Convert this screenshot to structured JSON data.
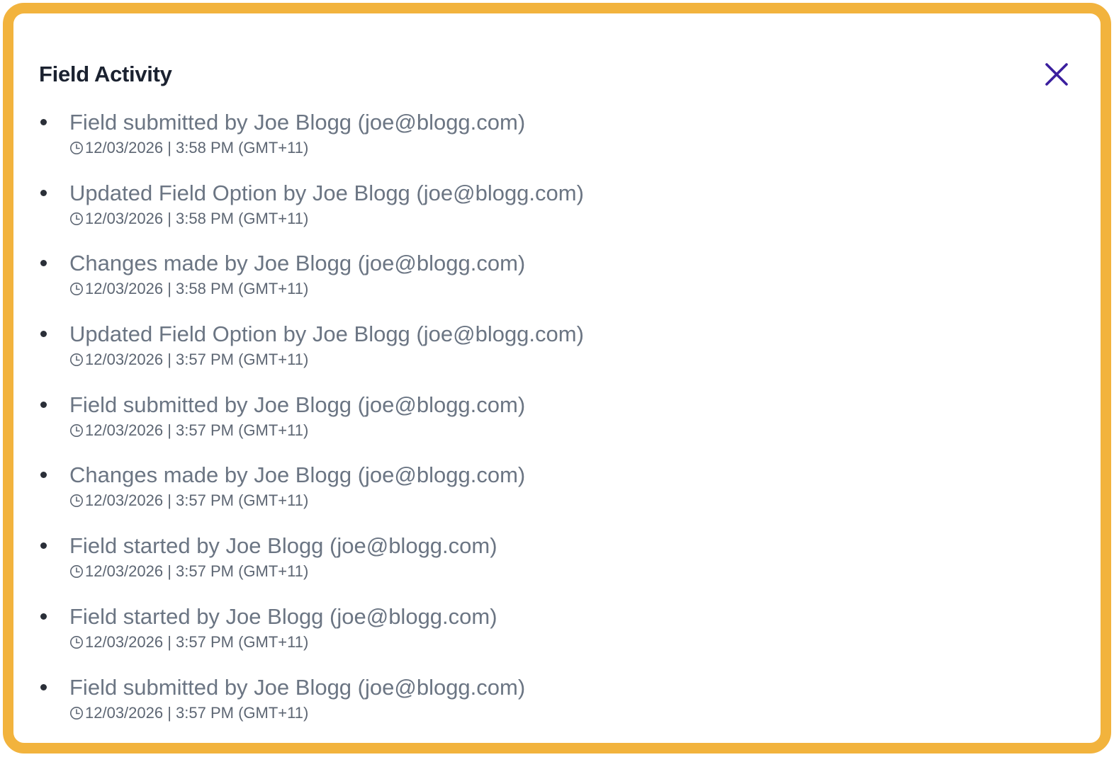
{
  "dialog": {
    "title": "Field Activity",
    "close_icon": "close-icon",
    "accent_border_color": "#F2B33D",
    "close_icon_color": "#3B1F9E"
  },
  "activities": [
    {
      "text": "Field submitted by Joe Blogg (joe@blogg.com)",
      "timestamp": "12/03/2026 | 3:58 PM (GMT+11)"
    },
    {
      "text": "Updated Field Option by Joe Blogg (joe@blogg.com)",
      "timestamp": "12/03/2026 | 3:58 PM (GMT+11)"
    },
    {
      "text": "Changes made by Joe Blogg (joe@blogg.com)",
      "timestamp": "12/03/2026 | 3:58 PM (GMT+11)"
    },
    {
      "text": "Updated Field Option by Joe Blogg (joe@blogg.com)",
      "timestamp": "12/03/2026 | 3:57 PM (GMT+11)"
    },
    {
      "text": "Field submitted by Joe Blogg (joe@blogg.com)",
      "timestamp": "12/03/2026 | 3:57 PM (GMT+11)"
    },
    {
      "text": "Changes made by Joe Blogg (joe@blogg.com)",
      "timestamp": "12/03/2026 | 3:57 PM (GMT+11)"
    },
    {
      "text": "Field started by Joe Blogg (joe@blogg.com)",
      "timestamp": "12/03/2026 | 3:57 PM (GMT+11)"
    },
    {
      "text": "Field started by Joe Blogg (joe@blogg.com)",
      "timestamp": "12/03/2026 | 3:57 PM (GMT+11)"
    },
    {
      "text": "Field submitted by Joe Blogg (joe@blogg.com)",
      "timestamp": "12/03/2026 | 3:57 PM (GMT+11)"
    }
  ]
}
